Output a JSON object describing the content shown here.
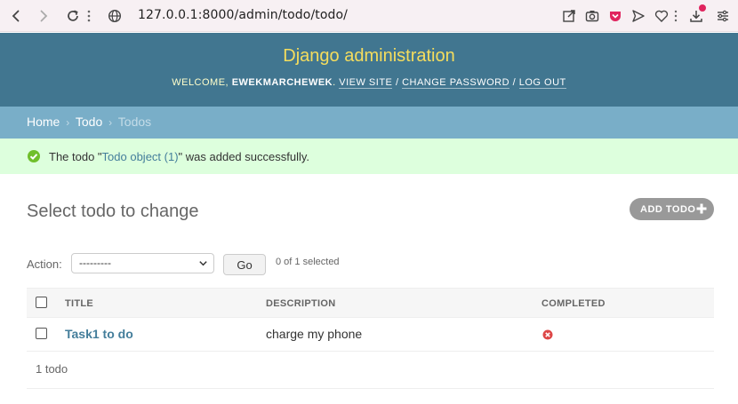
{
  "browser": {
    "url": "127.0.0.1:8000/admin/todo/todo/"
  },
  "header": {
    "branding": "Django administration",
    "welcome": "Welcome,",
    "username": "ewekmarchewek",
    "view_site": "View site",
    "change_password": "Change password",
    "log_out": "Log out",
    "separator": "/"
  },
  "breadcrumbs": {
    "home": "Home",
    "app": "Todo",
    "current": "Todos",
    "separator": "›"
  },
  "message": {
    "prefix": "The todo \"",
    "link": "Todo object (1)",
    "suffix": "\" was added successfully."
  },
  "content": {
    "title": "Select todo to change",
    "add_button": "Add todo",
    "action_label": "Action:",
    "action_selected": "---------",
    "go_button": "Go",
    "selected_count": "0 of 1 selected"
  },
  "table": {
    "columns": [
      "Title",
      "Description",
      "Completed"
    ],
    "rows": [
      {
        "title": "Task1 to do",
        "description": "charge my phone",
        "completed": false
      }
    ],
    "paginator": "1 todo"
  },
  "colors": {
    "header_bg": "#417690",
    "branding": "#f5dd5d",
    "breadcrumbs_bg": "#79aec8",
    "success_bg": "#dfd",
    "link": "#447e9b",
    "false_icon": "#dd4646",
    "success_icon": "#70bf2b"
  }
}
